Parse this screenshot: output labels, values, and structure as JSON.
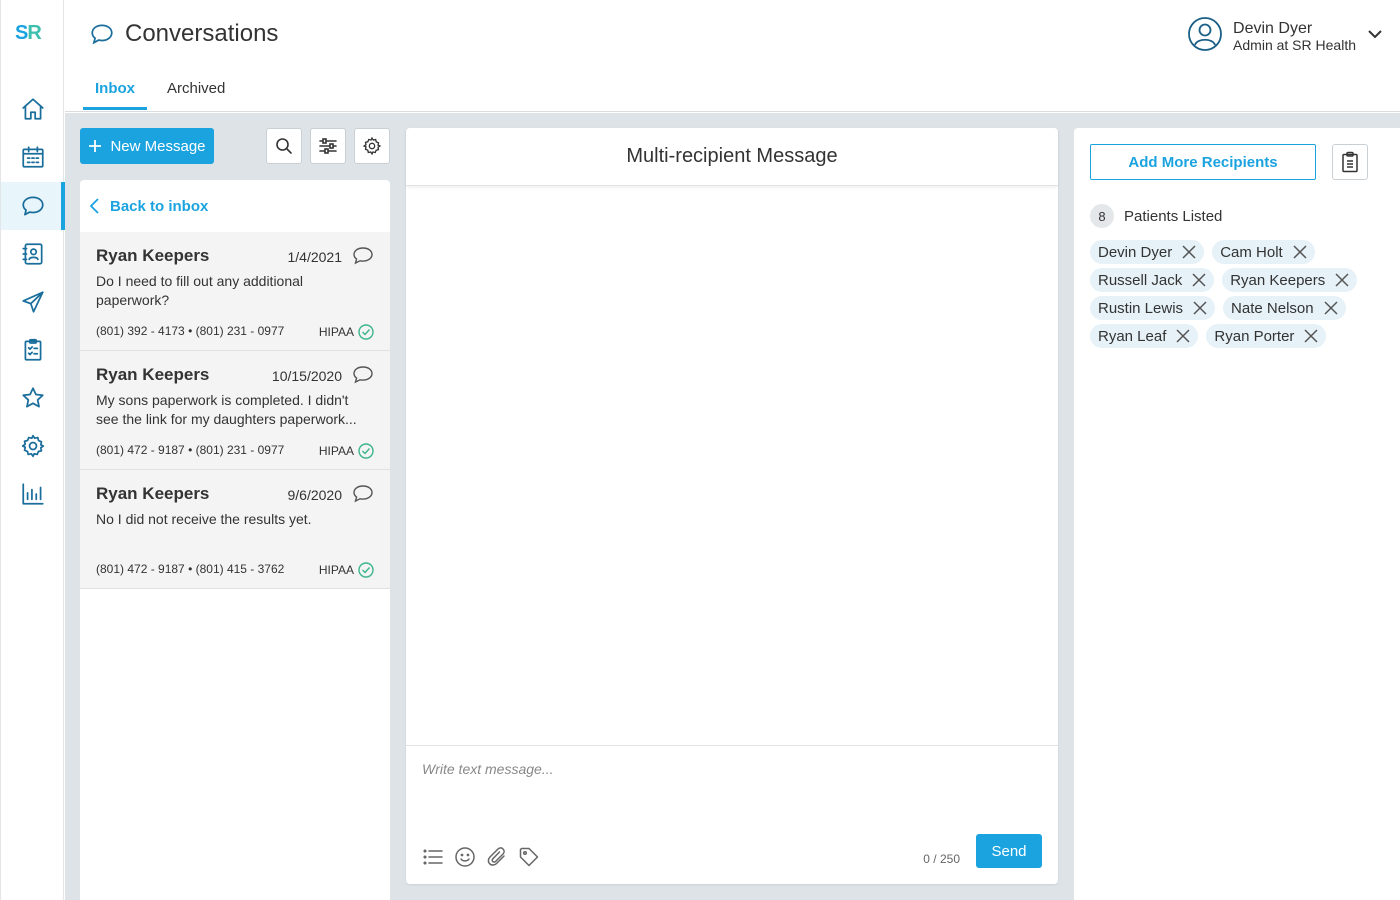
{
  "app": {
    "logo_s": "S",
    "logo_r": "R"
  },
  "header": {
    "title": "Conversations",
    "tabs": [
      {
        "label": "Inbox",
        "active": true
      },
      {
        "label": "Archived",
        "active": false
      }
    ],
    "user": {
      "name": "Devin Dyer",
      "role": "Admin at SR Health"
    }
  },
  "nav": [
    "home-icon",
    "calendar-icon",
    "chat-icon",
    "contacts-icon",
    "send-icon",
    "clipboard-icon",
    "star-icon",
    "gear-icon",
    "chart-icon"
  ],
  "toolbar": {
    "new_message_label": "New Message"
  },
  "list": {
    "back_label": "Back to inbox",
    "conversations": [
      {
        "name": "Ryan Keepers",
        "date": "1/4/2021",
        "text": "Do I need to fill out any additional paperwork?",
        "meta": "(801) 392 - 4173  •  (801) 231 - 0977",
        "badge": "HIPAA"
      },
      {
        "name": "Ryan Keepers",
        "date": "10/15/2020",
        "text": "My sons paperwork is completed. I didn't see the link for my daughters paperwork...",
        "meta": "(801) 472 - 9187  •  (801) 231 - 0977",
        "badge": "HIPAA"
      },
      {
        "name": "Ryan Keepers",
        "date": "9/6/2020",
        "text": "No I did not receive the results yet.",
        "meta": "(801) 472 - 9187  •  (801) 415 - 3762",
        "badge": "HIPAA"
      }
    ]
  },
  "message": {
    "title": "Multi-recipient Message",
    "placeholder": "Write text message...",
    "counter": "0 / 250",
    "send_label": "Send"
  },
  "recipients": {
    "add_label": "Add More Recipients",
    "count": "8",
    "count_label": "Patients Listed",
    "list": [
      "Devin Dyer",
      "Cam Holt",
      "Russell Jack",
      "Ryan Keepers",
      "Rustin Lewis",
      "Nate Nelson",
      "Ryan Leaf",
      "Ryan Porter"
    ]
  },
  "colors": {
    "accent": "#1ba3e0",
    "nav_icon": "#1a6e9c",
    "hipaa_check": "#3bb58a",
    "workspace_bg": "#dde3e7"
  }
}
